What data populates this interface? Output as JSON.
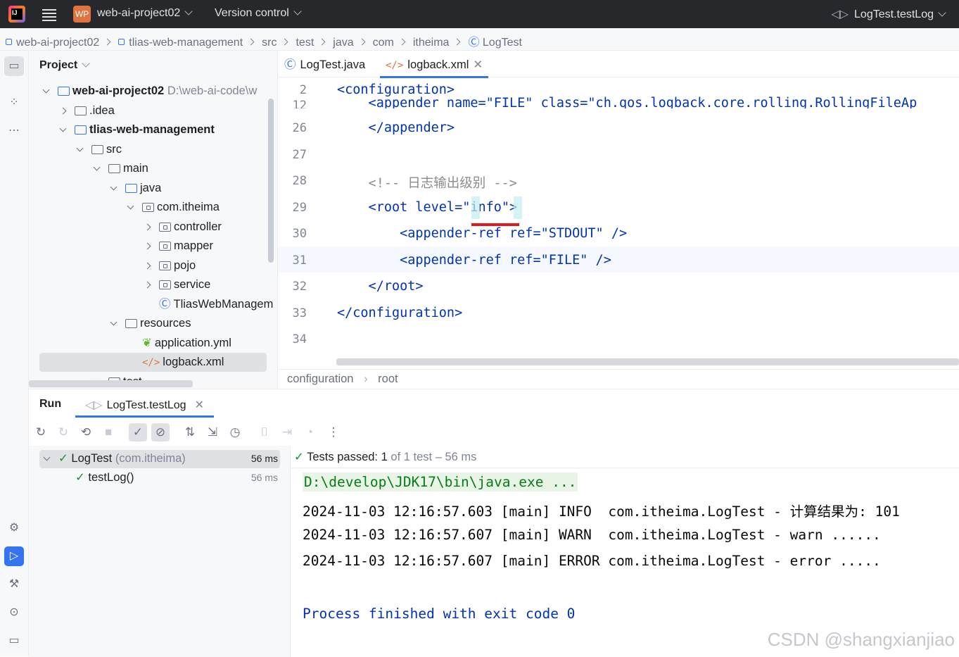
{
  "titlebar": {
    "logo": "IJ",
    "project_badge": "WP",
    "project_name": "web-ai-project02",
    "version_control": "Version control",
    "run_config": "LogTest.testLog"
  },
  "breadcrumb": [
    "web-ai-project02",
    "tlias-web-management",
    "src",
    "test",
    "java",
    "com",
    "itheima",
    "LogTest"
  ],
  "project_panel": {
    "title": "Project",
    "tree": [
      {
        "label": "web-ai-project02",
        "suffix": "D:\\web-ai-code\\w",
        "bold": true
      },
      {
        "label": ".idea"
      },
      {
        "label": "tlias-web-management",
        "bold": true
      },
      {
        "label": "src"
      },
      {
        "label": "main"
      },
      {
        "label": "java"
      },
      {
        "label": "com.itheima"
      },
      {
        "label": "controller"
      },
      {
        "label": "mapper"
      },
      {
        "label": "pojo"
      },
      {
        "label": "service"
      },
      {
        "label": "TliasWebManagem"
      },
      {
        "label": "resources"
      },
      {
        "label": "application.yml"
      },
      {
        "label": "logback.xml"
      },
      {
        "label": "test"
      }
    ]
  },
  "editor": {
    "tabs": [
      {
        "label": "LogTest.java",
        "icon": "class-icon"
      },
      {
        "label": "logback.xml",
        "icon": "xml-icon",
        "active": true
      }
    ],
    "lines": [
      {
        "num": "2",
        "text": "<configuration>"
      },
      {
        "num": "12",
        "text": "    <appender name=\"FILE\" class=\"ch.qos.logback.core.rolling.RollingFileAp"
      },
      {
        "num": "26",
        "text": "    </appender>"
      },
      {
        "num": "27",
        "text": ""
      },
      {
        "num": "28",
        "text": "    <!-- 日志输出级别 -->"
      },
      {
        "num": "29",
        "text": "    <root level=\"info\">"
      },
      {
        "num": "30",
        "text": "        <appender-ref ref=\"STDOUT\" />"
      },
      {
        "num": "31",
        "text": "        <appender-ref ref=\"FILE\" />"
      },
      {
        "num": "32",
        "text": "    </root>"
      },
      {
        "num": "33",
        "text": "</configuration>"
      },
      {
        "num": "34",
        "text": ""
      }
    ],
    "bottom_crumbs": [
      "configuration",
      "root"
    ]
  },
  "run": {
    "label": "Run",
    "tab": "LogTest.testLog",
    "tests": [
      {
        "name": "LogTest",
        "pkg": "(com.itheima)",
        "time": "56 ms"
      },
      {
        "name": "testLog()",
        "time": "56 ms"
      }
    ],
    "status_prefix": "Tests passed:",
    "status_count": "1",
    "status_of": "of",
    "status_total": "1 test",
    "status_time": "– 56 ms",
    "console": [
      "D:\\develop\\JDK17\\bin\\java.exe ...",
      "2024-11-03 12:16:57.603 [main] INFO  com.itheima.LogTest - 计算结果为: 101",
      "2024-11-03 12:16:57.607 [main] WARN  com.itheima.LogTest - warn ......",
      "2024-11-03 12:16:57.607 [main] ERROR com.itheima.LogTest - error .....",
      "",
      "Process finished with exit code 0"
    ]
  },
  "watermark": "CSDN @shangxianjiao",
  "colors": {
    "accent": "#3574f0",
    "titlebar": "#27282c",
    "pass": "#208a3c",
    "error_underline": "#e01b1b"
  }
}
